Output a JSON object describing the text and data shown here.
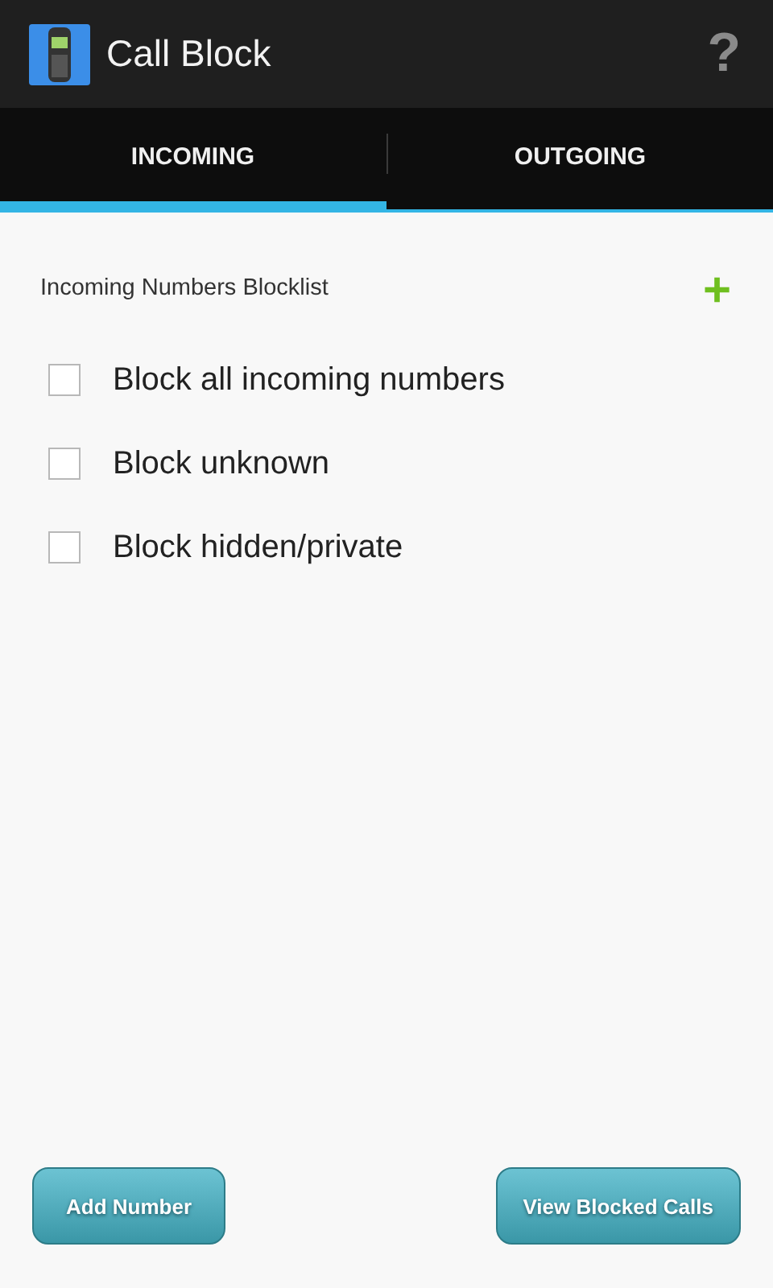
{
  "app_bar": {
    "title": "Call Block",
    "help": "?"
  },
  "tabs": [
    {
      "label": "INCOMING",
      "selected": true
    },
    {
      "label": "OUTGOING",
      "selected": false
    }
  ],
  "section": {
    "title": "Incoming Numbers Blocklist",
    "add": "+"
  },
  "options": [
    {
      "label": "Block all incoming numbers",
      "checked": false
    },
    {
      "label": "Block unknown",
      "checked": false
    },
    {
      "label": "Block hidden/private",
      "checked": false
    }
  ],
  "buttons": [
    "Add Number",
    "View Blocked Calls"
  ]
}
